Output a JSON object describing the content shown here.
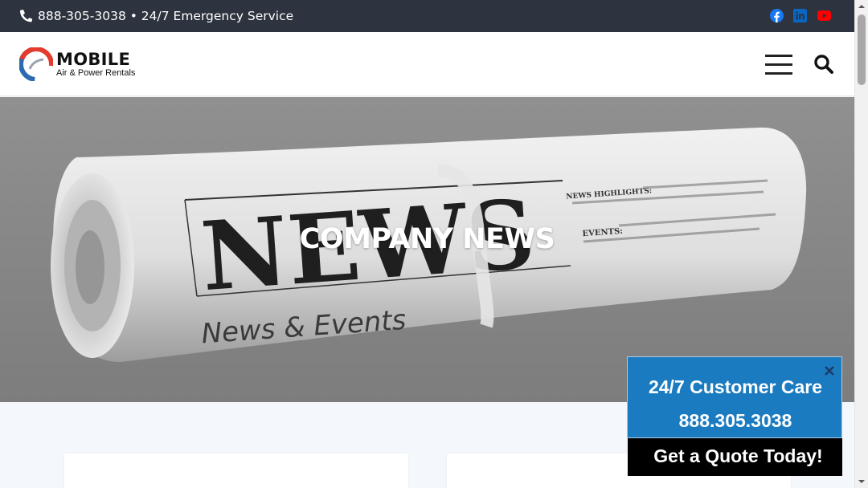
{
  "topbar": {
    "phone_text": "888-305-3038 • 24/7 Emergency Service",
    "social": [
      "facebook-icon",
      "linkedin-icon",
      "youtube-icon"
    ]
  },
  "header": {
    "logo_title": "MOBILE",
    "logo_subtitle": "Air & Power Rentals",
    "menu_icon": "hamburger-icon",
    "search_icon": "search-icon"
  },
  "hero": {
    "title": "COMPANY NEWS",
    "image_masthead": "NEWS",
    "image_caption": "News & Events",
    "image_highlights_label": "NEWS HIGHLIGHTS:",
    "image_events_label": "EVENTS:"
  },
  "widget": {
    "care_title": "24/7 Customer Care",
    "care_phone": "888.305.3038",
    "quote_label": "Get a Quote Today!",
    "close_icon": "close-icon"
  },
  "colors": {
    "topbar_bg": "#2d333f",
    "widget_blue": "#1b7bc0",
    "logo_red": "#e53a2e",
    "logo_blue": "#2b6cb0",
    "facebook": "#1877f2",
    "linkedin": "#0a66c2",
    "youtube": "#ff0000"
  }
}
